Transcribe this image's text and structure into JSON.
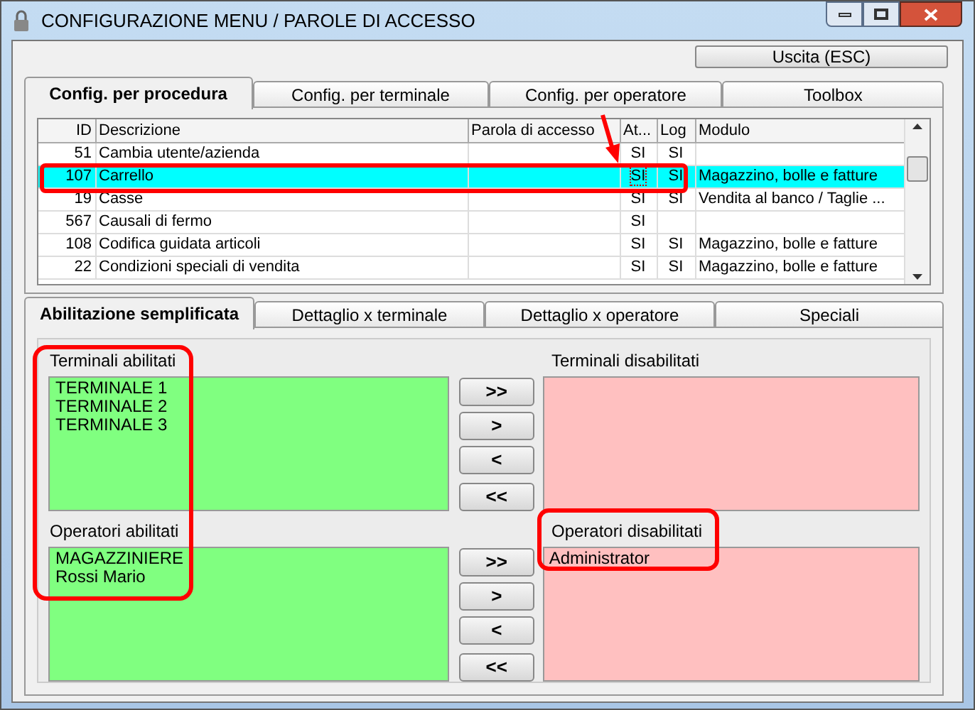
{
  "window": {
    "title": "CONFIGURAZIONE MENU / PAROLE DI ACCESSO"
  },
  "exit_button": "Uscita (ESC)",
  "tabs": [
    {
      "label": "Config. per procedura",
      "selected": true
    },
    {
      "label": "Config. per terminale",
      "selected": false
    },
    {
      "label": "Config. per operatore",
      "selected": false
    },
    {
      "label": "Toolbox",
      "selected": false
    }
  ],
  "table": {
    "columns": [
      "ID",
      "Descrizione",
      "Parola di accesso",
      "At...",
      "Log",
      "Modulo"
    ],
    "rows": [
      {
        "cells": [
          "51",
          "Cambia utente/azienda",
          "",
          "SI",
          "SI",
          ""
        ],
        "selected": false
      },
      {
        "cells": [
          "107",
          "Carrello",
          "",
          "SI",
          "SI",
          "Magazzino, bolle e fatture"
        ],
        "selected": true
      },
      {
        "cells": [
          "19",
          "Casse",
          "",
          "SI",
          "SI",
          "Vendita al banco / Taglie ..."
        ],
        "selected": false
      },
      {
        "cells": [
          "567",
          "Causali di fermo",
          "",
          "SI",
          "",
          ""
        ],
        "selected": false
      },
      {
        "cells": [
          "108",
          "Codifica guidata articoli",
          "",
          "SI",
          "SI",
          "Magazzino, bolle e fatture"
        ],
        "selected": false
      },
      {
        "cells": [
          "22",
          "Condizioni speciali di vendita",
          "",
          "SI",
          "SI",
          "Magazzino, bolle e fatture"
        ],
        "selected": false
      }
    ]
  },
  "subtabs": [
    {
      "label": "Abilitazione semplificata",
      "selected": true
    },
    {
      "label": "Dettaglio x terminale",
      "selected": false
    },
    {
      "label": "Dettaglio x operatore",
      "selected": false
    },
    {
      "label": "Speciali",
      "selected": false
    }
  ],
  "groups": [
    {
      "enabled_label": "Terminali abilitati",
      "enabled": [
        "TERMINALE 1",
        "TERMINALE 2",
        "TERMINALE 3"
      ],
      "disabled_label": "Terminali disabilitati",
      "buttons": [
        ">>",
        ">",
        "<",
        "<<"
      ]
    },
    {
      "enabled_label": "Operatori abilitati",
      "enabled": [
        "MAGAZZINIERE",
        "Rossi Mario"
      ],
      "disabled_label": "Operatori disabilitati",
      "disabled": [
        "Administrator"
      ],
      "buttons": [
        ">>",
        ">",
        "<",
        "<<"
      ]
    }
  ]
}
